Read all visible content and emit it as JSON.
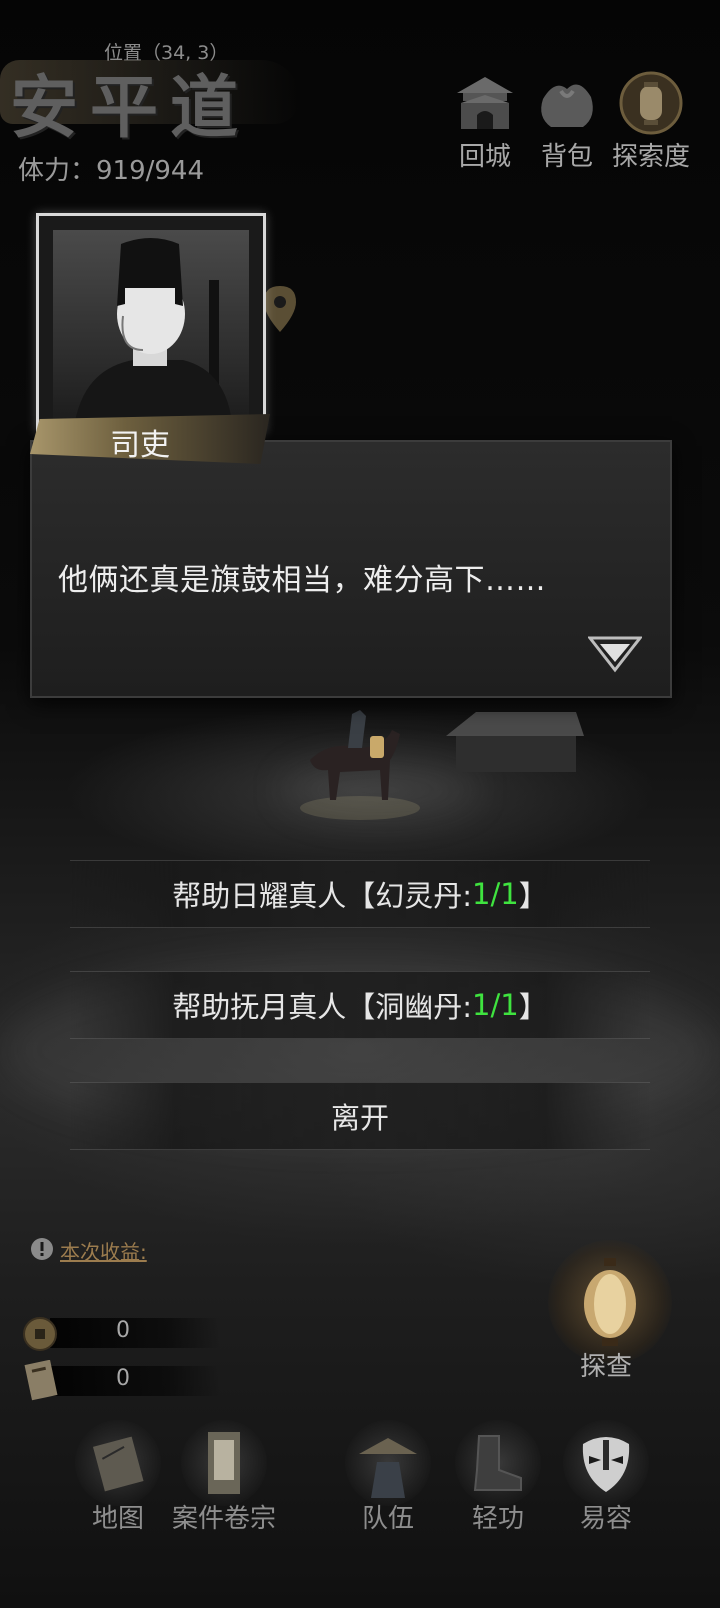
{
  "header": {
    "location_label": "位置（34, 3）",
    "area_title": "安平道",
    "stamina": "体力：919/944"
  },
  "top_buttons": [
    {
      "label": "回城",
      "icon": "city-gate-icon"
    },
    {
      "label": "背包",
      "icon": "bundle-icon"
    },
    {
      "label": "探索度",
      "icon": "lantern-icon"
    }
  ],
  "dialog": {
    "speaker": "司吏",
    "text": "他俩还真是旗鼓相当，难分高下……",
    "next_icon": "next-arrow-icon"
  },
  "choices": [
    {
      "prefix": "帮助日耀真人【幻灵丹:",
      "count": "1/1",
      "suffix": "】"
    },
    {
      "prefix": "帮助抚月真人【洞幽丹:",
      "count": "1/1",
      "suffix": "】"
    },
    {
      "prefix": "离开",
      "count": "",
      "suffix": ""
    }
  ],
  "earnings": {
    "label": "本次收益:",
    "coins": "0",
    "documents": "0"
  },
  "investigate": {
    "label": "探查"
  },
  "nav": [
    {
      "label": "地图",
      "icon": "map-scroll-icon"
    },
    {
      "label": "案件卷宗",
      "icon": "case-file-icon"
    },
    {
      "label": "队伍",
      "icon": "team-icon"
    },
    {
      "label": "轻功",
      "icon": "boots-icon"
    },
    {
      "label": "易容",
      "icon": "mask-icon"
    }
  ],
  "colors": {
    "highlight_count": "#3fe33f",
    "earnings_label": "#9c7c4e"
  }
}
